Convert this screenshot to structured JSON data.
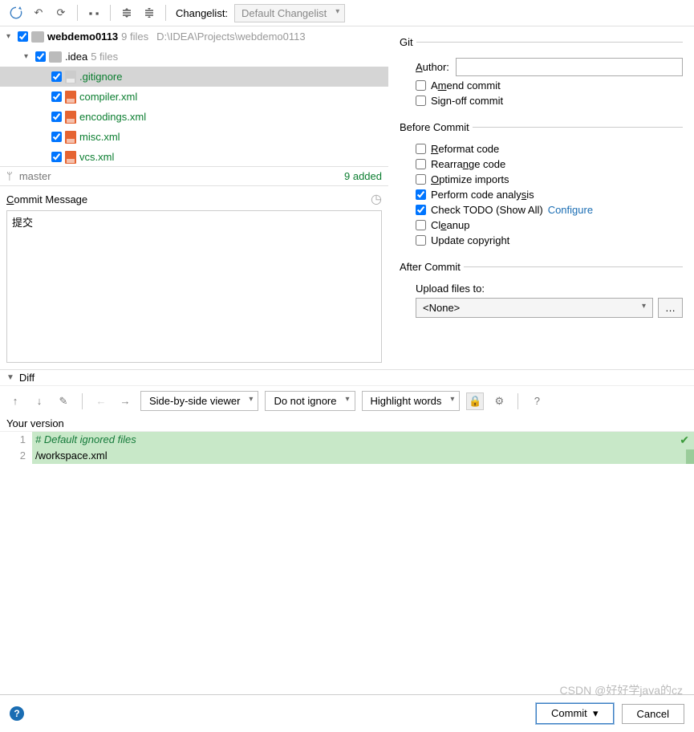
{
  "toolbar": {
    "changelist_label": "Changelist:",
    "changelist_value": "Default Changelist"
  },
  "tree": {
    "root": {
      "name": "webdemo0113",
      "meta": "9 files",
      "path": "D:\\IDEA\\Projects\\webdemo0113"
    },
    "idea": {
      "name": ".idea",
      "meta": "5 files"
    },
    "files": [
      {
        "name": ".gitignore"
      },
      {
        "name": "compiler.xml"
      },
      {
        "name": "encodings.xml"
      },
      {
        "name": "misc.xml"
      },
      {
        "name": "vcs.xml"
      }
    ]
  },
  "branch_bar": {
    "branch": "master",
    "added": "9 added"
  },
  "commit": {
    "title": "Commit Message",
    "text": "提交"
  },
  "git": {
    "legend": "Git",
    "author_label": "Author:",
    "author_value": "",
    "amend": "Amend commit",
    "signoff": "Sign-off commit"
  },
  "before": {
    "legend": "Before Commit",
    "reformat": "Reformat code",
    "rearrange": "Rearrange code",
    "optimize": "Optimize imports",
    "analysis": "Perform code analysis",
    "todo": "Check TODO (Show All)",
    "configure": "Configure",
    "cleanup": "Cleanup",
    "copyright": "Update copyright"
  },
  "after": {
    "legend": "After Commit",
    "upload_label": "Upload files to:",
    "upload_value": "<None>"
  },
  "diff": {
    "label": "Diff",
    "viewer": "Side-by-side viewer",
    "ignore": "Do not ignore",
    "highlight": "Highlight words",
    "your_version": "Your version"
  },
  "code": {
    "line1": "# Default ignored files",
    "line2": "/workspace.xml"
  },
  "buttons": {
    "commit": "Commit",
    "cancel": "Cancel"
  },
  "watermark": "CSDN @好好学java的cz"
}
